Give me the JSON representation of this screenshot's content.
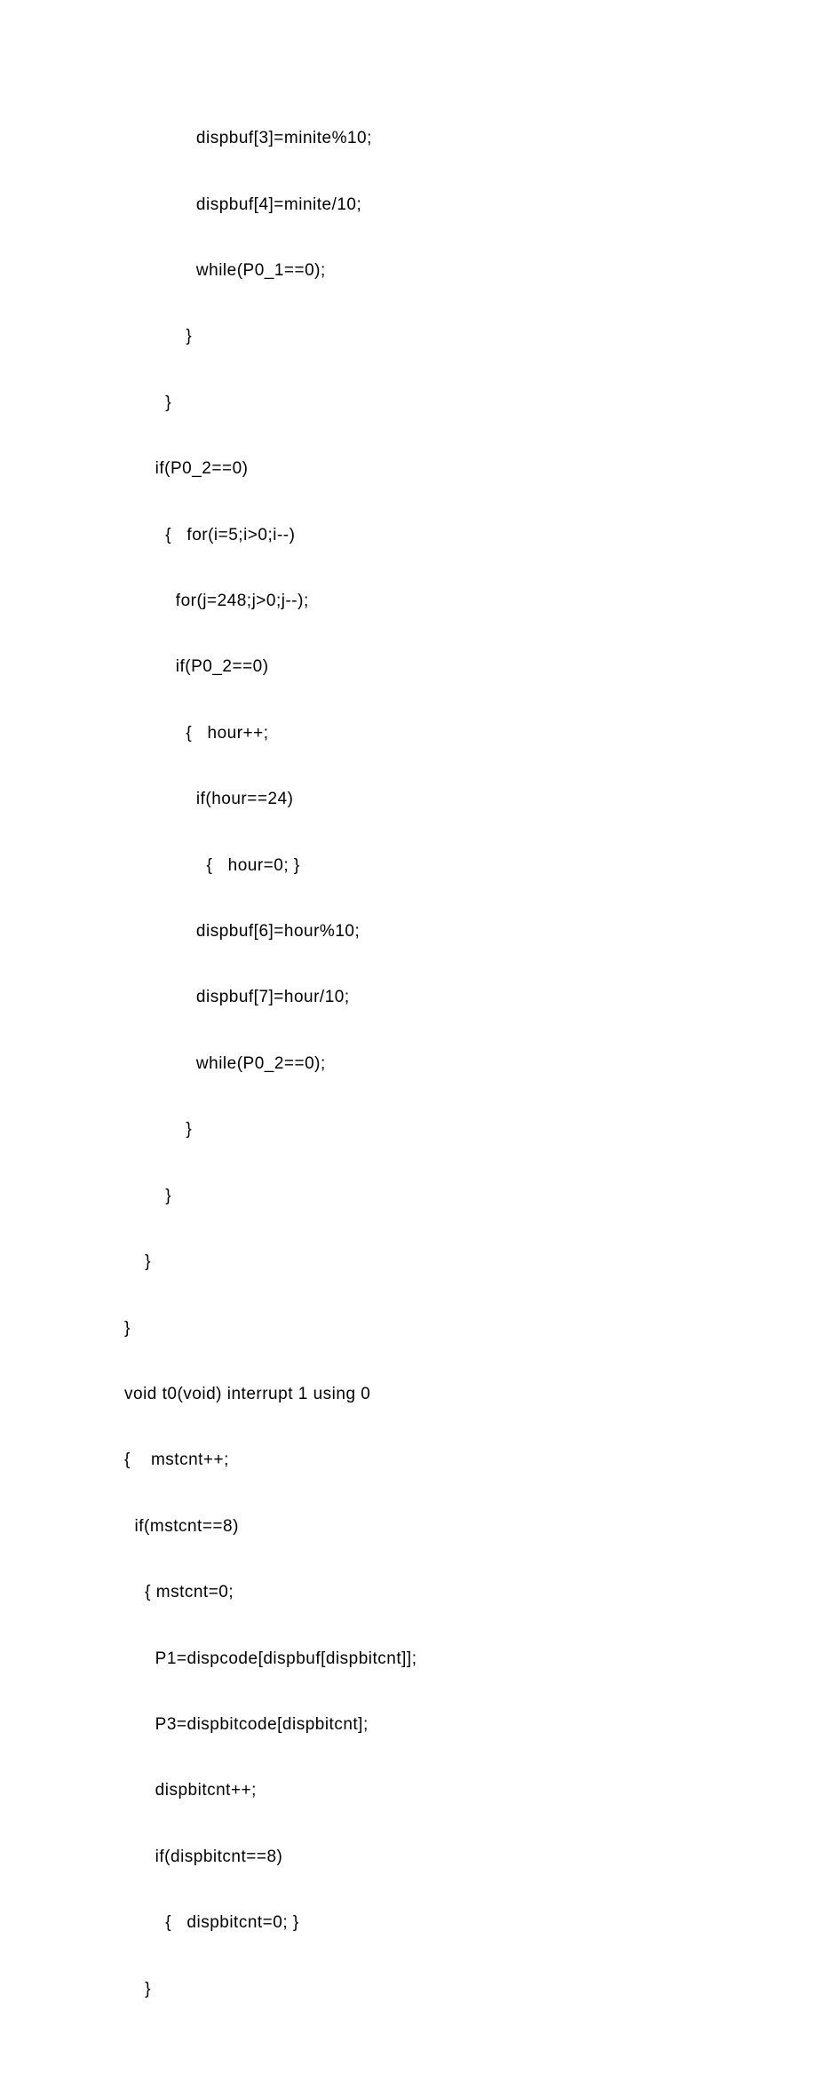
{
  "code_lines": [
    "              dispbuf[3]=minite%10;",
    "              dispbuf[4]=minite/10;",
    "              while(P0_1==0);",
    "            }",
    "        }",
    "      if(P0_2==0)",
    "        {   for(i=5;i>0;i--)",
    "          for(j=248;j>0;j--);",
    "          if(P0_2==0)",
    "            {   hour++;",
    "              if(hour==24)",
    "                {   hour=0; }",
    "              dispbuf[6]=hour%10;",
    "              dispbuf[7]=hour/10;",
    "              while(P0_2==0);",
    "            }",
    "        }",
    "    }",
    "}",
    "void t0(void) interrupt 1 using 0",
    "{    mstcnt++;",
    "  if(mstcnt==8)",
    "    { mstcnt=0;",
    "      P1=dispcode[dispbuf[dispbitcnt]];",
    "      P3=dispbitcode[dispbitcnt];",
    "      dispbitcnt++;",
    "      if(dispbitcnt==8)",
    "        {   dispbitcnt=0; }",
    "    }"
  ]
}
